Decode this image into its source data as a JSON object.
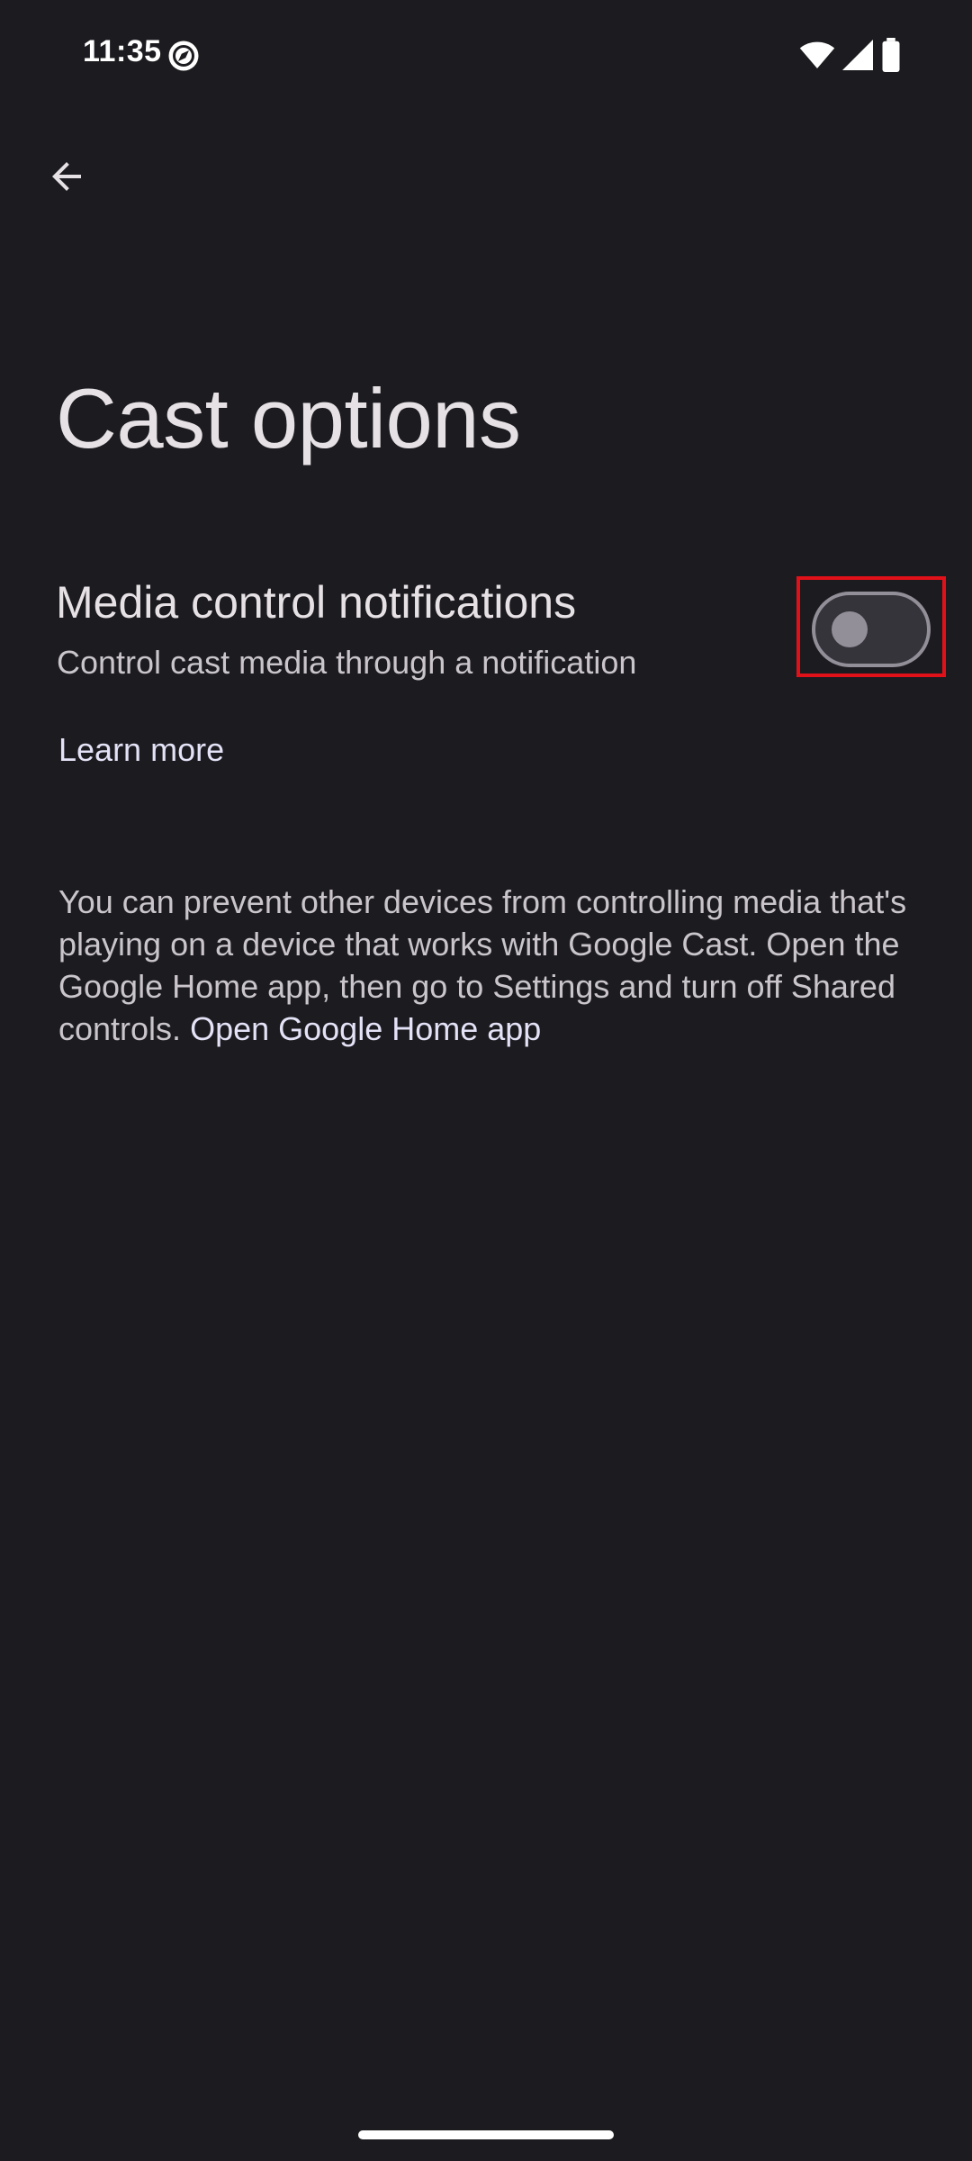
{
  "status_bar": {
    "time": "11:35",
    "left_icon": "compass-icon",
    "right_icons": [
      "wifi-icon",
      "cellular-signal-icon",
      "battery-icon"
    ]
  },
  "toolbar": {
    "back_icon": "arrow-back-icon"
  },
  "page": {
    "title": "Cast options"
  },
  "setting": {
    "title": "Media control notifications",
    "summary": "Control cast media through a notification",
    "toggle_state": "off"
  },
  "links": {
    "learn_more": "Learn more"
  },
  "footer": {
    "text": "You can prevent other devices from controlling media that's playing on a device that works with Google Cast. Open the Google Home app, then go to Settings and turn off Shared controls. ",
    "link": "Open Google Home app"
  },
  "colors": {
    "background": "#1c1b1f",
    "highlight": "#e1111a",
    "toggle_outline": "#938f99"
  }
}
